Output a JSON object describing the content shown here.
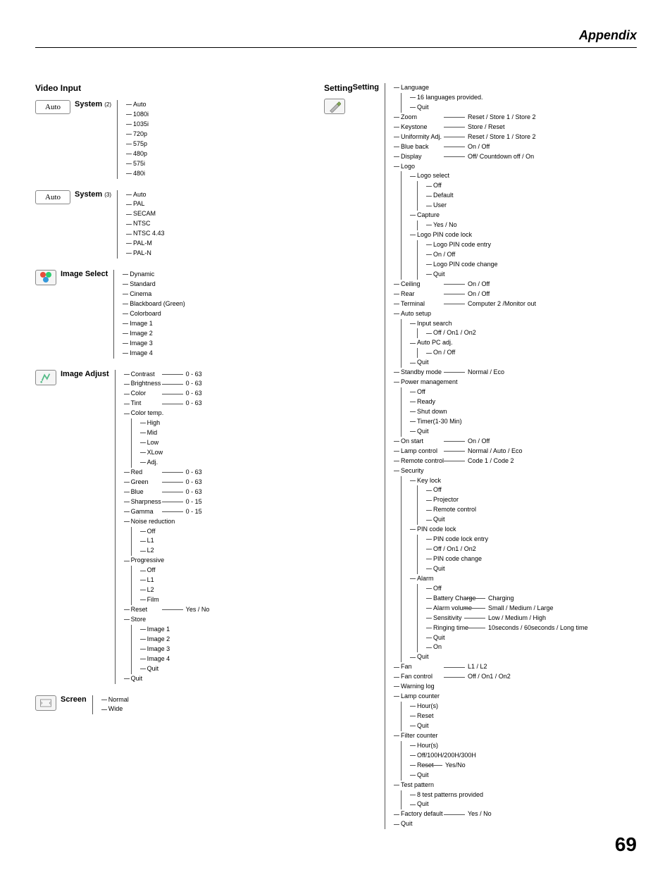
{
  "header": {
    "title": "Appendix",
    "page_number": "69"
  },
  "left": {
    "section_title": "Video Input",
    "system2": {
      "icon_text": "Auto",
      "label": "System",
      "sub": "(2)",
      "items": [
        "Auto",
        "1080i",
        "1035i",
        "720p",
        "575p",
        "480p",
        "575i",
        "480i"
      ]
    },
    "system3": {
      "icon_text": "Auto",
      "label": "System",
      "sub": "(3)",
      "items": [
        "Auto",
        "PAL",
        "SECAM",
        "NTSC",
        "NTSC 4.43",
        "PAL-M",
        "PAL-N"
      ]
    },
    "image_select": {
      "label": "Image Select",
      "items": [
        "Dynamic",
        "Standard",
        "Cinema",
        "Blackboard (Green)",
        "Colorboard",
        "Image 1",
        "Image 2",
        "Image 3",
        "Image 4"
      ]
    },
    "image_adjust": {
      "label": "Image Adjust",
      "contrast": {
        "k": "Contrast",
        "v": "0 - 63"
      },
      "brightness": {
        "k": "Brightness",
        "v": "0 - 63"
      },
      "color": {
        "k": "Color",
        "v": "0 - 63"
      },
      "tint": {
        "k": "Tint",
        "v": "0 - 63"
      },
      "color_temp": {
        "k": "Color temp.",
        "items": [
          "High",
          "Mid",
          "Low",
          "XLow",
          "Adj."
        ]
      },
      "red": {
        "k": "Red",
        "v": "0 - 63"
      },
      "green": {
        "k": "Green",
        "v": "0 - 63"
      },
      "blue": {
        "k": "Blue",
        "v": "0 - 63"
      },
      "sharpness": {
        "k": "Sharpness",
        "v": "0 - 15"
      },
      "gamma": {
        "k": "Gamma",
        "v": "0 - 15"
      },
      "noise": {
        "k": "Noise reduction",
        "items": [
          "Off",
          "L1",
          "L2"
        ]
      },
      "progressive": {
        "k": "Progressive",
        "items": [
          "Off",
          "L1",
          "L2",
          "Film"
        ]
      },
      "reset": {
        "k": "Reset",
        "v": "Yes / No"
      },
      "store": {
        "k": "Store",
        "items": [
          "Image 1",
          "Image 2",
          "Image 3",
          "Image 4",
          "Quit"
        ]
      },
      "quit": "Quit"
    },
    "screen": {
      "label": "Screen",
      "items": [
        "Normal",
        "Wide"
      ]
    }
  },
  "right": {
    "section_title": "Setting",
    "root_label": "Setting",
    "language": {
      "k": "Language",
      "items": [
        "16 languages provided.",
        "Quit"
      ]
    },
    "zoom": {
      "k": "Zoom",
      "v": "Reset / Store 1 / Store 2"
    },
    "keystone": {
      "k": "Keystone",
      "v": "Store / Reset"
    },
    "uniformity": {
      "k": "Uniformity Adj.",
      "v": "Reset / Store 1 / Store 2"
    },
    "blue_back": {
      "k": "Blue back",
      "v": "On / Off"
    },
    "display": {
      "k": "Display",
      "v": "Off/ Countdown off / On"
    },
    "logo": {
      "k": "Logo",
      "logo_select": {
        "k": "Logo select",
        "items": [
          "Off",
          "Default",
          "User"
        ]
      },
      "capture": {
        "k": "Capture",
        "items": [
          "Yes / No"
        ]
      },
      "pin_lock": {
        "k": "Logo PIN code lock",
        "items": [
          "Logo PIN code entry",
          "On / Off",
          "Logo PIN code change",
          "Quit"
        ]
      }
    },
    "ceiling": {
      "k": "Ceiling",
      "v": "On / Off"
    },
    "rear": {
      "k": "Rear",
      "v": "On / Off"
    },
    "terminal": {
      "k": "Terminal",
      "v": "Computer 2 /Monitor out"
    },
    "auto_setup": {
      "k": "Auto setup",
      "input_search": {
        "k": "Input search",
        "v": "Off / On1 / On2"
      },
      "auto_pc": {
        "k": "Auto PC adj.",
        "v": "On / Off"
      },
      "quit": "Quit"
    },
    "standby": {
      "k": "Standby mode",
      "v": "Normal / Eco"
    },
    "power_mgmt": {
      "k": "Power management",
      "items": [
        "Off",
        "Ready",
        "Shut down",
        "Timer(1-30 Min)",
        "Quit"
      ]
    },
    "on_start": {
      "k": "On start",
      "v": "On / Off"
    },
    "lamp_control": {
      "k": "Lamp control",
      "v": "Normal / Auto / Eco"
    },
    "remote_control": {
      "k": "Remote control",
      "v": "Code 1 / Code 2"
    },
    "security": {
      "k": "Security",
      "key_lock": {
        "k": "Key lock",
        "items": [
          "Off",
          "Projector",
          "Remote control",
          "Quit"
        ]
      },
      "pin_lock": {
        "k": "PIN code lock",
        "items": [
          "PIN code lock entry",
          "Off / On1 / On2",
          "PIN code change",
          "Quit"
        ]
      },
      "alarm": {
        "k": "Alarm",
        "off": "Off",
        "battery": {
          "k": "Battery Charge",
          "v": "Charging"
        },
        "volume": {
          "k": "Alarm volume",
          "v": "Small / Medium / Large"
        },
        "sensitivity": {
          "k": "Sensitivity",
          "v": "Low / Medium / High"
        },
        "ringing": {
          "k": "Ringing time",
          "v": "10seconds / 60seconds / Long time"
        },
        "quit": "Quit",
        "on": "On"
      },
      "quit": "Quit"
    },
    "fan": {
      "k": "Fan",
      "v": "L1 / L2"
    },
    "fan_control": {
      "k": "Fan control",
      "v": "Off / On1 / On2"
    },
    "warning_log": "Warning log",
    "lamp_counter": {
      "k": "Lamp counter",
      "items": [
        "Hour(s)",
        "Reset",
        "Quit"
      ]
    },
    "filter_counter": {
      "k": "Filter counter",
      "hours": "Hour(s)",
      "off": "Off/100H/200H/300H",
      "reset": {
        "k": "Reset",
        "v": "Yes/No"
      },
      "quit": "Quit"
    },
    "test_pattern": {
      "k": "Test pattern",
      "items": [
        "8 test patterns provided",
        "Quit"
      ]
    },
    "factory_default": {
      "k": "Factory default",
      "v": "Yes / No"
    },
    "quit": "Quit"
  }
}
